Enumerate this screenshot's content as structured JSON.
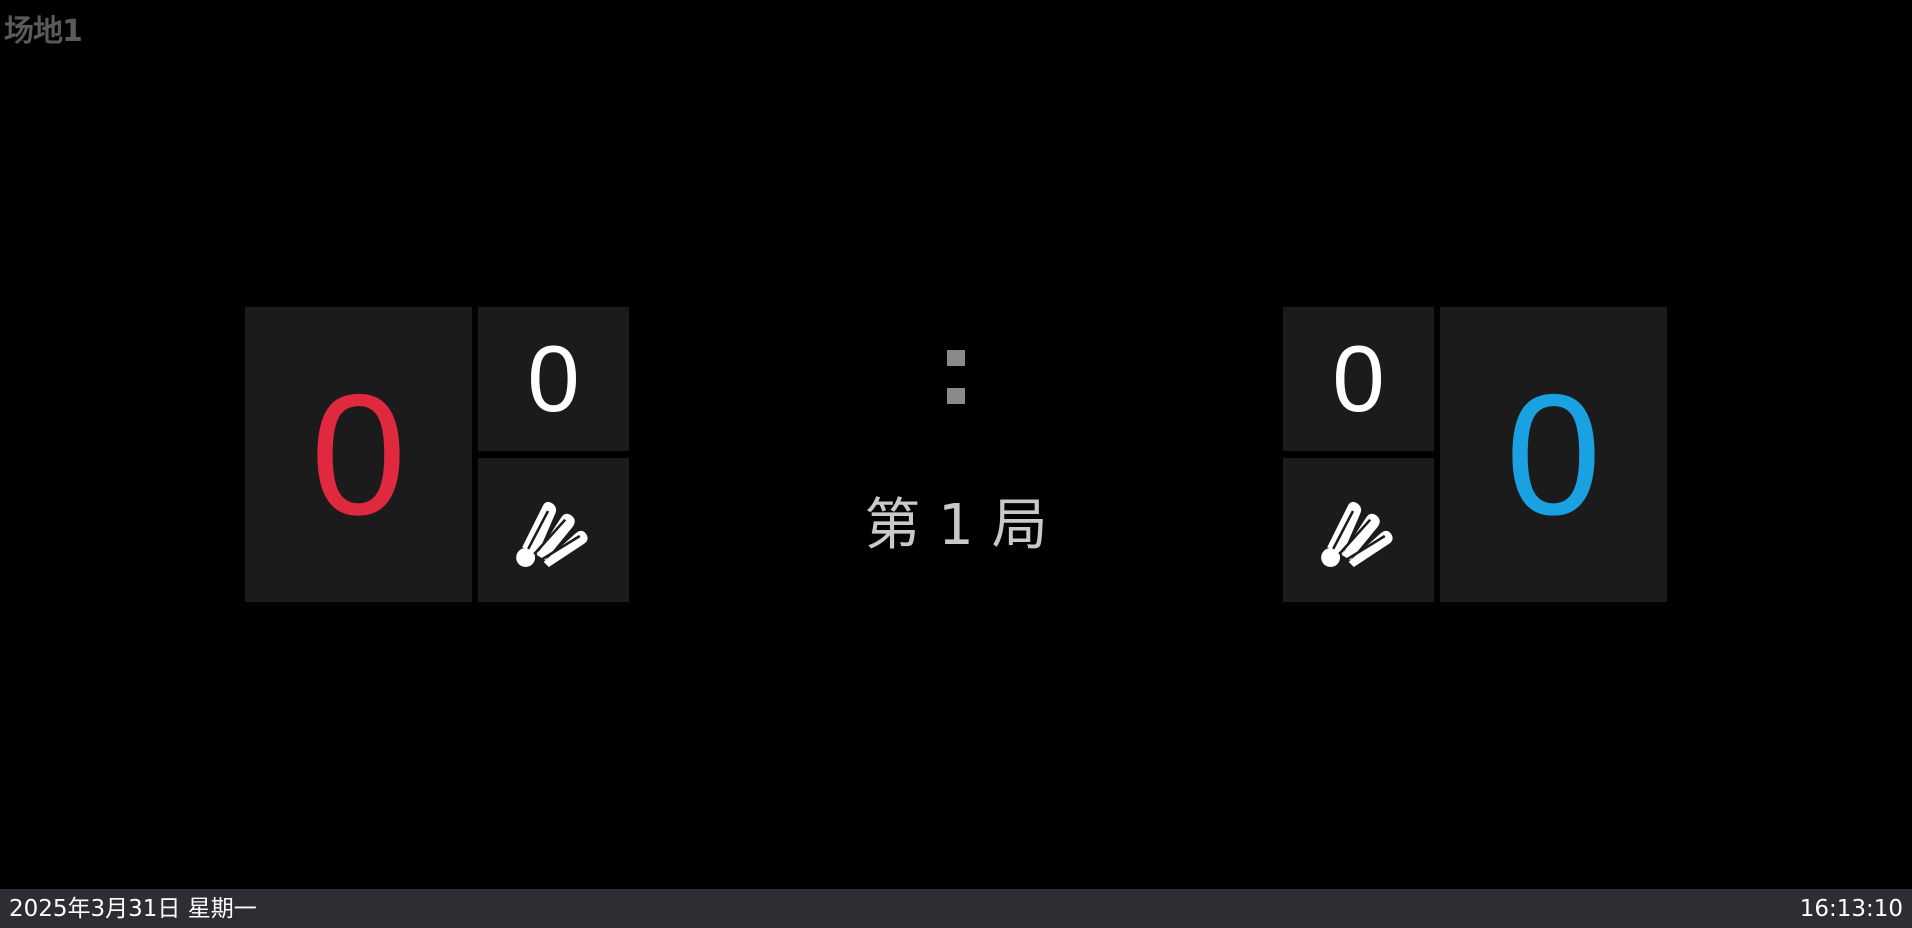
{
  "court": {
    "label": "场地1"
  },
  "left_team": {
    "score": "0",
    "games": "0",
    "color": "#e0283f",
    "serve_icon": "shuttlecock-icon"
  },
  "right_team": {
    "score": "0",
    "games": "0",
    "color": "#1aa1e2",
    "serve_icon": "shuttlecock-icon"
  },
  "match": {
    "separator": ":",
    "round_label": "第 1 局"
  },
  "status_bar": {
    "date": "2025年3月31日 星期一",
    "time": "16:13:10"
  }
}
